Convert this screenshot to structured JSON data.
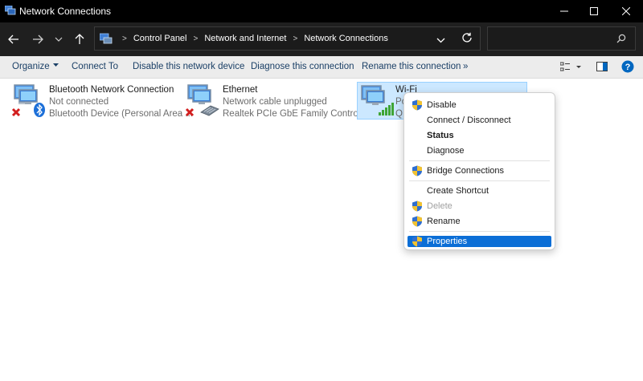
{
  "window": {
    "title": "Network Connections",
    "controls": {
      "minimize": "minimize-icon",
      "maximize": "maximize-icon",
      "close": "close-icon"
    }
  },
  "address_bar": {
    "breadcrumbs": [
      "Control Panel",
      "Network and Internet",
      "Network Connections"
    ],
    "search_placeholder": ""
  },
  "toolbar": {
    "organize": "Organize",
    "connect_to": "Connect To",
    "disable": "Disable this network device",
    "diagnose": "Diagnose this connection",
    "rename": "Rename this connection",
    "more": "»"
  },
  "connections": [
    {
      "name": "Bluetooth Network Connection",
      "status": "Not connected",
      "device": "Bluetooth Device (Personal Area ..."
    },
    {
      "name": "Ethernet",
      "status": "Network cable unplugged",
      "device": "Realtek PCIe GbE Family Controller"
    },
    {
      "name": "Wi-Fi",
      "status": "Po",
      "device": "Q"
    }
  ],
  "context_menu": {
    "items": [
      {
        "label": "Disable",
        "shield": true,
        "bold": false,
        "disabled": false
      },
      {
        "label": "Connect / Disconnect",
        "shield": false,
        "bold": false,
        "disabled": false
      },
      {
        "label": "Status",
        "shield": false,
        "bold": true,
        "disabled": false
      },
      {
        "label": "Diagnose",
        "shield": false,
        "bold": false,
        "disabled": false
      },
      {
        "label": "Bridge Connections",
        "shield": true,
        "bold": false,
        "disabled": false
      },
      {
        "label": "Create Shortcut",
        "shield": false,
        "bold": false,
        "disabled": false
      },
      {
        "label": "Delete",
        "shield": true,
        "bold": false,
        "disabled": true
      },
      {
        "label": "Rename",
        "shield": true,
        "bold": false,
        "disabled": false
      },
      {
        "label": "Properties",
        "shield": true,
        "bold": false,
        "disabled": false,
        "highlighted": true
      }
    ]
  },
  "colors": {
    "titlebar": "#000000",
    "address_bar": "#1f1f1f",
    "command_bar": "#ececec",
    "selection": "#cce8ff",
    "menu_highlight": "#0b6ed6",
    "help": "#0067c0"
  }
}
